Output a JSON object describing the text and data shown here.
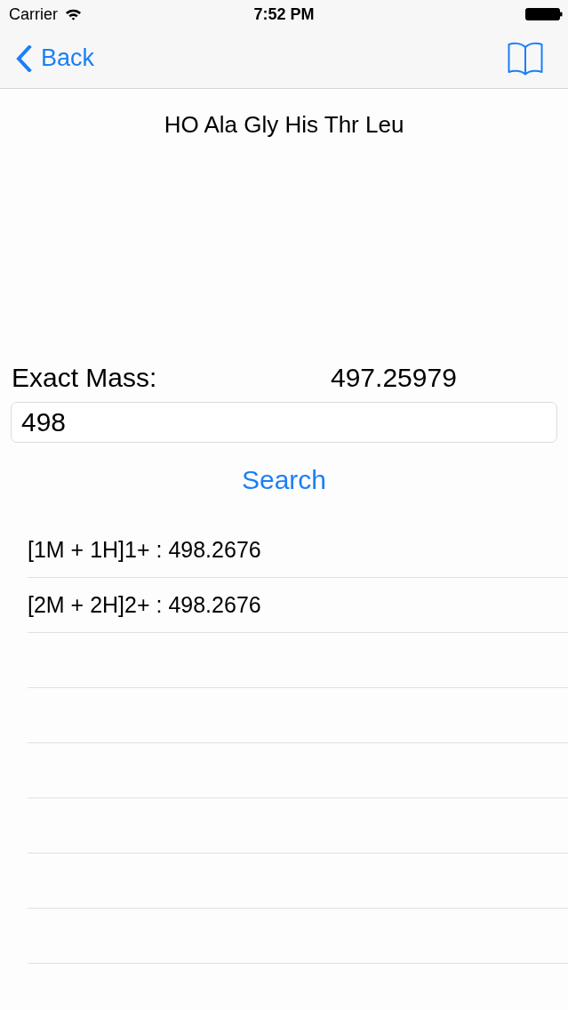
{
  "status_bar": {
    "carrier": "Carrier",
    "time": "7:52 PM"
  },
  "nav_bar": {
    "back_label": "Back"
  },
  "sequence": "HO Ala Gly His Thr Leu",
  "exact_mass": {
    "label": "Exact Mass:",
    "value": "497.25979"
  },
  "mass_field": {
    "value": "498"
  },
  "search_button": {
    "label": "Search"
  },
  "results": [
    {
      "text": "[1M + 1H]1+ : 498.2676"
    },
    {
      "text": "[2M + 2H]2+ : 498.2676"
    }
  ]
}
